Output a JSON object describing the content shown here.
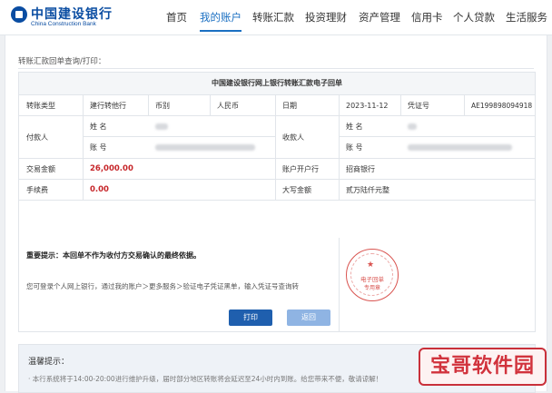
{
  "header": {
    "logo_cn": "中国建设银行",
    "logo_en": "China Construction Bank",
    "nav": [
      "首页",
      "我的账户",
      "转账汇款",
      "投资理财",
      "资产管理",
      "信用卡",
      "个人贷款",
      "生活服务"
    ],
    "active_nav": "我的账户"
  },
  "page": {
    "title": "转账汇款回单查询/打印："
  },
  "receipt": {
    "title": "中国建设银行网上银行转账汇款电子回单",
    "transfer_type_label": "转账类型",
    "transfer_type_value": "建行转他行",
    "currency_label": "币别",
    "currency_value": "人民币",
    "date_label": "日期",
    "date_value": "2023-11-12",
    "voucher_label": "凭证号",
    "voucher_value": "AE199898094918",
    "payer_label": "付款人",
    "payee_label": "收款人",
    "name_label": "姓 名",
    "account_label": "账 号",
    "payee_name_value": "",
    "amount_label": "交易金额",
    "amount_value": "26,000.00",
    "payee_bank_label": "账户开户行",
    "payee_bank_value": "招商银行",
    "fee_label": "手续费",
    "fee_value": "0.00",
    "uppercase_label": "大写金额",
    "uppercase_value": "贰万陆仟元整",
    "important_notice": "重要提示：本回单不作为收付方交易确认的最终依据。",
    "verify_text": "您可登录个人网上银行，通过我的账户＞更多服务＞验证电子凭证黑单，输入凭证号查询转",
    "stamp_line1": "电子回单",
    "stamp_line2": "专用章"
  },
  "buttons": {
    "print": "打印",
    "back": "返回"
  },
  "tips": {
    "title": "温馨提示：",
    "text": "· 本行系统将于14:00-20:00进行维护升级，届时部分地区转账将会延迟至24小时内到账。给您带来不便，敬请谅解！"
  },
  "watermark": {
    "text": "宝哥软件园"
  },
  "colors": {
    "brand_blue": "#0a4da2",
    "nav_active": "#1a6fc2",
    "amount_red": "#c6262a",
    "button_primary": "#1f5fae",
    "button_secondary": "#8fb4e3",
    "watermark_red": "#d1323c"
  }
}
